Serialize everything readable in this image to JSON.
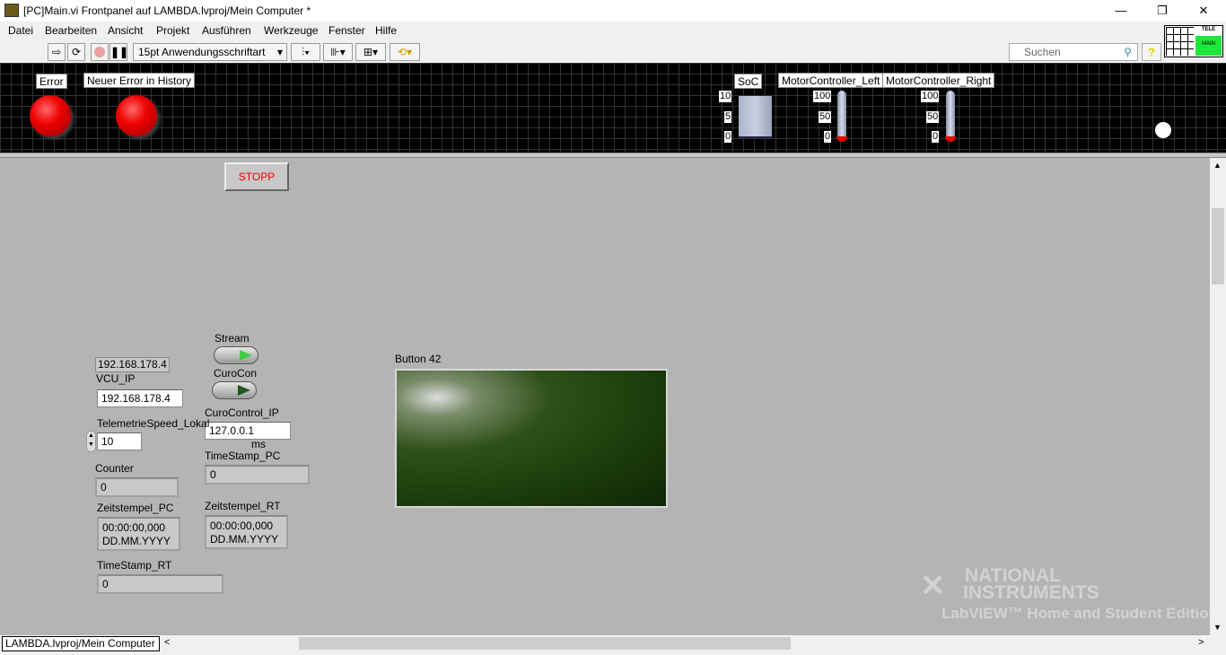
{
  "window": {
    "title": "[PC]Main.vi Frontpanel auf LAMBDA.lvproj/Mein Computer *",
    "minimize": "—",
    "restore": "❐",
    "close": "✕"
  },
  "menu": [
    "Datei",
    "Bearbeiten",
    "Ansicht",
    "Projekt",
    "Ausführen",
    "Werkzeuge",
    "Fenster",
    "Hilfe"
  ],
  "toolbar": {
    "font": "15pt Anwendungsschriftart",
    "search_placeholder": "Suchen",
    "help": "?",
    "icon_top": "TELE",
    "icon_bottom": "MAIN"
  },
  "top_panel": {
    "error_label": "Error",
    "history_label": "Neuer Error in History",
    "soc": {
      "label": "SoC",
      "ticks": [
        "10",
        "5",
        "0"
      ],
      "value": 0
    },
    "motor_left": {
      "label": "MotorController_Left",
      "ticks": [
        "100",
        "50",
        "0"
      ],
      "value": 0
    },
    "motor_right": {
      "label": "MotorController_Right",
      "ticks": [
        "100",
        "50",
        "0"
      ],
      "value": 0
    }
  },
  "main": {
    "stop": "STOPP",
    "ip_display": "192.168.178.4",
    "vcu_ip_label": "VCU_IP",
    "vcu_ip": "192.168.178.4",
    "stream_label": "Stream",
    "curocon_label": "CuroCon",
    "curocontrol_ip_label": "CuroControl_IP",
    "curocontrol_ip": "127.0.0.1",
    "telemetry_label": "TelemetrieSpeed_Lokal",
    "telemetry_value": "10",
    "ms": "ms",
    "timestamp_pc_label": "TimeStamp_PC",
    "timestamp_pc": "0",
    "counter_label": "Counter",
    "counter": "0",
    "zeit_pc_label": "Zeitstempel_PC",
    "zeit_pc_time": "00:00:00,000",
    "zeit_pc_date": "DD.MM.YYYY",
    "zeit_rt_label": "Zeitstempel_RT",
    "zeit_rt_time": "00:00:00,000",
    "zeit_rt_date": "DD.MM.YYYY",
    "timestamp_rt_label": "TimeStamp_RT",
    "timestamp_rt": "0",
    "button42_label": "Button 42"
  },
  "watermark": {
    "line1": "NATIONAL",
    "line2": "INSTRUMENTS",
    "line3": "LabVIEW™ Home and Student Edition"
  },
  "status": "LAMBDA.lvproj/Mein Computer"
}
